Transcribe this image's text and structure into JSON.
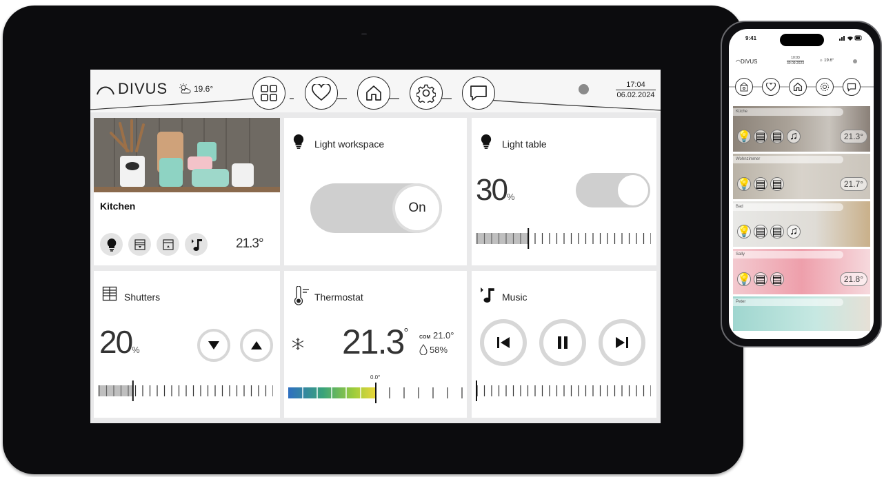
{
  "topbar": {
    "brand": "DIVUS",
    "weather_temp": "19.6°",
    "time": "17:04",
    "date": "06.02.2024"
  },
  "nav": [
    {
      "name": "grid-icon"
    },
    {
      "name": "heart-icon"
    },
    {
      "name": "home-icon"
    },
    {
      "name": "gear-icon"
    },
    {
      "name": "chat-icon"
    }
  ],
  "kitchen": {
    "name": "Kitchen",
    "temperature": "21.3°",
    "controls": [
      "bulb-icon",
      "shutter-icon",
      "shutter-icon",
      "music-icon"
    ]
  },
  "light_workspace": {
    "title": "Light workspace",
    "state": "On"
  },
  "light_table": {
    "title": "Light table",
    "value": "30",
    "unit": "%",
    "level": 0.3
  },
  "shutters": {
    "title": "Shutters",
    "value": "20",
    "unit": "%",
    "level": 0.2
  },
  "thermostat": {
    "title": "Thermostat",
    "temperature": "21.3",
    "degree_symbol": "°",
    "comfort_label": "COM",
    "comfort_value": "21.0°",
    "humidity": "58%",
    "offset": "0.0°"
  },
  "music": {
    "title": "Music",
    "level": 0.0
  },
  "phone": {
    "time": "9:41",
    "brand": "DIVUS",
    "clock_time": "10:03",
    "clock_date": "30.09.2023",
    "weather": "19.6°",
    "rooms": [
      {
        "name": "Küche",
        "temperature": "21.3°"
      },
      {
        "name": "Wohnzimmer",
        "temperature": "21.7°"
      },
      {
        "name": "Bad",
        "temperature": ""
      },
      {
        "name": "Sally",
        "temperature": "21.8°"
      },
      {
        "name": "Peter",
        "temperature": ""
      }
    ]
  },
  "colors": {
    "tablet_frame": "#0c0c0e",
    "tile_bg": "#ffffff",
    "screen_bg": "#e9e9ea",
    "toggle": "#cfcfcf",
    "thermo_gradient": [
      "#2f6fc1",
      "#3aa37a",
      "#9ccc3c",
      "#e8d63a"
    ]
  }
}
